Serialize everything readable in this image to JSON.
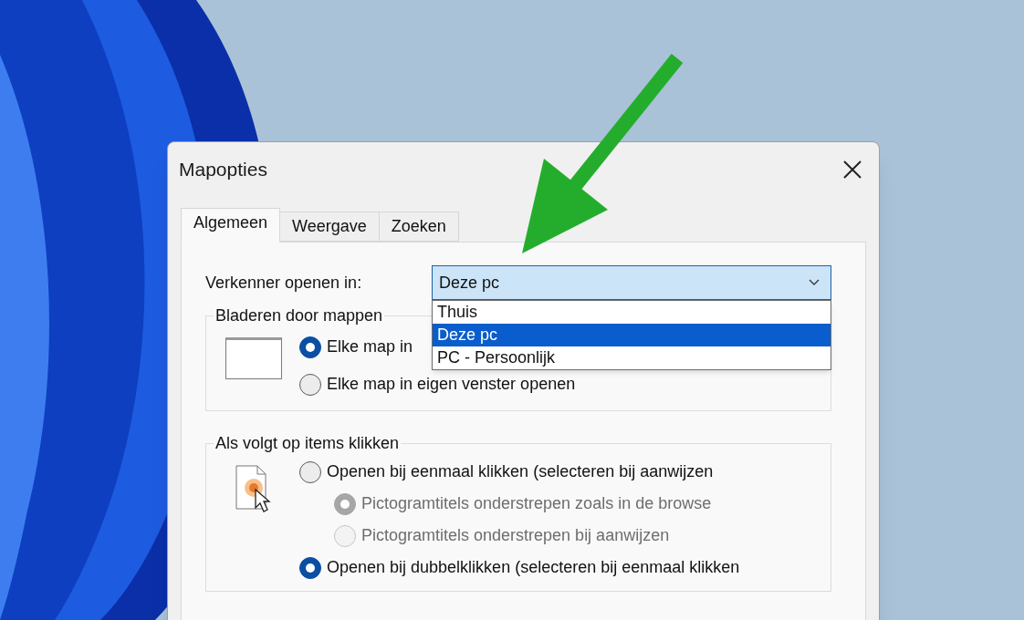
{
  "window": {
    "title": "Mapopties"
  },
  "tabs": [
    {
      "label": "Algemeen",
      "selected": true
    },
    {
      "label": "Weergave",
      "selected": false
    },
    {
      "label": "Zoeken",
      "selected": false
    }
  ],
  "open_in": {
    "label": "Verkenner openen in:",
    "value": "Deze pc",
    "expanded": true,
    "options": [
      {
        "label": "Thuis",
        "selected": false
      },
      {
        "label": "Deze pc",
        "selected": true
      },
      {
        "label": "PC - Persoonlijk",
        "selected": false
      }
    ]
  },
  "groups": [
    {
      "title": "Bladeren door mappen",
      "kind": "window",
      "options": [
        {
          "label": "Elke map in",
          "selected": true,
          "disabled": false
        },
        {
          "label": "Elke map in eigen venster openen",
          "selected": false,
          "disabled": false
        }
      ]
    },
    {
      "title": "Als volgt op items klikken",
      "kind": "click",
      "options": [
        {
          "label": "Openen bij eenmaal klikken (selecteren bij aanwijzen",
          "selected": false,
          "disabled": false,
          "children": [
            {
              "label": "Pictogramtitels onderstrepen zoals in de browse",
              "selected": true,
              "disabled": true
            },
            {
              "label": "Pictogramtitels onderstrepen bij aanwijzen",
              "selected": false,
              "disabled": true
            }
          ]
        },
        {
          "label": "Openen bij dubbelklikken (selecteren bij eenmaal klikken",
          "selected": true,
          "disabled": false
        }
      ]
    }
  ]
}
